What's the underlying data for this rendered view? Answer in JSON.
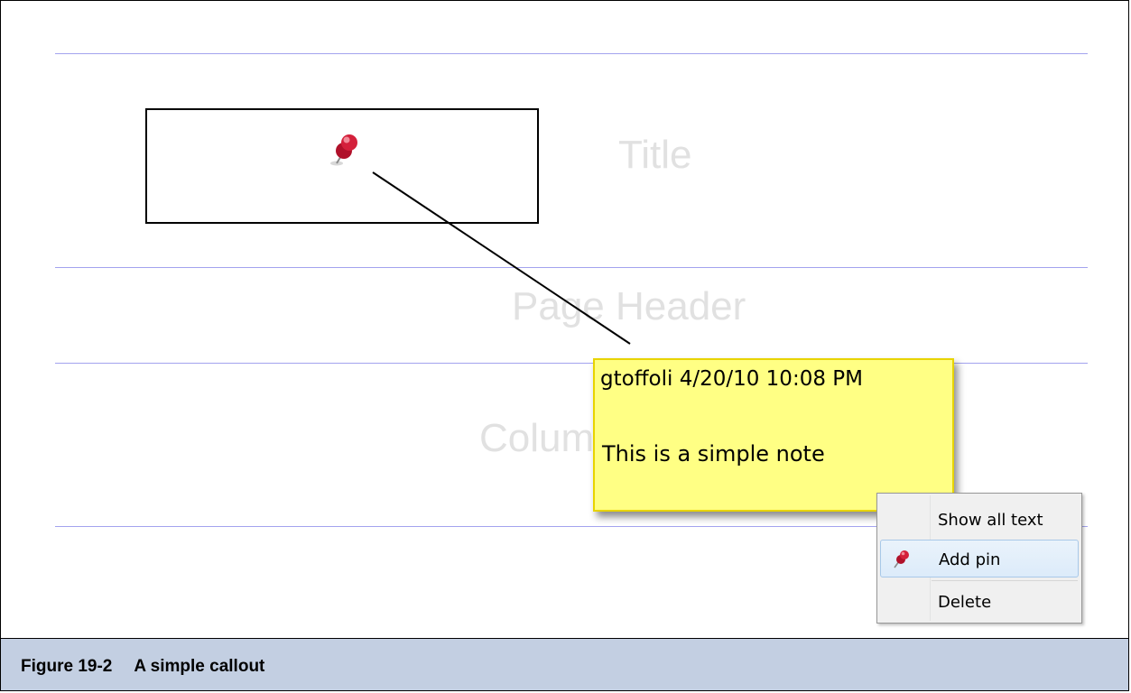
{
  "report_bands": {
    "title_label": "Title",
    "page_header_label": "Page Header",
    "column_header_label": "Column Header"
  },
  "note": {
    "header": "gtoffoli 4/20/10 10:08 PM",
    "body": "This is a simple note",
    "background_color": "#ffff84",
    "border_color": "#e8d400"
  },
  "context_menu": {
    "items": [
      {
        "label": "Show all text",
        "icon": null
      },
      {
        "label": "Add pin",
        "icon": "pushpin-icon",
        "highlighted": true
      },
      {
        "label": "Delete",
        "icon": null
      }
    ]
  },
  "caption": {
    "figure_number": "Figure 19-2",
    "title": "A simple callout",
    "background_color": "#c3cfe2"
  },
  "colors": {
    "band_line": "#a3a3ee",
    "band_label": "#e1e1e1",
    "pin": "#c8102e"
  }
}
